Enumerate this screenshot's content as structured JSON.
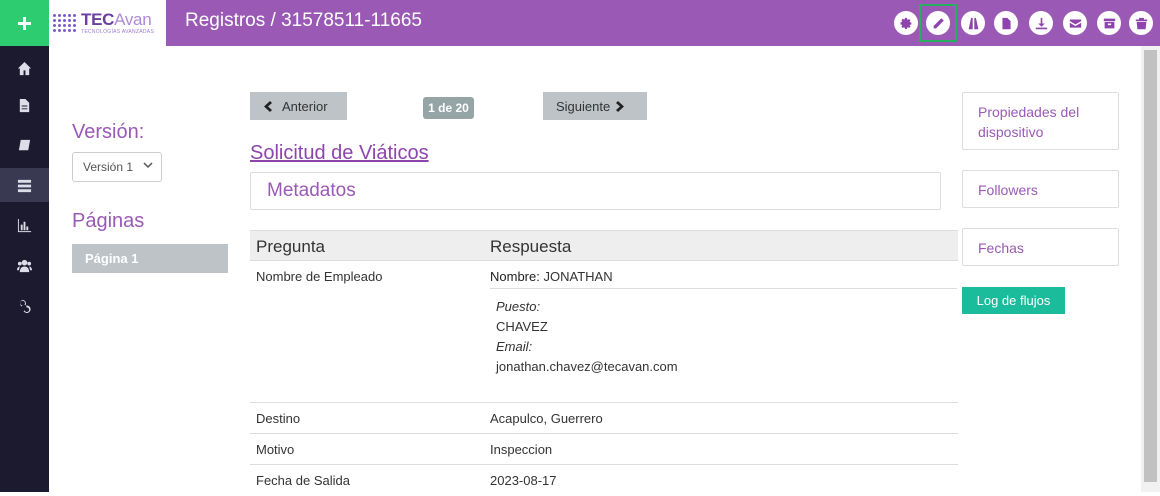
{
  "header": {
    "logo": {
      "main_tec": "TEC",
      "main_avan": "Avan",
      "sub": "TECNOLOGÍAS AVANZADAS"
    },
    "title": "Registros / 31578511-11665",
    "add_icon": "plus-icon",
    "colors": {
      "bar": "#9b59b6",
      "add": "#2ecc71",
      "highlight": "#27ae60"
    }
  },
  "toolbar": {
    "items": [
      {
        "icon": "gear-icon"
      },
      {
        "icon": "pencil-icon",
        "highlighted": true
      },
      {
        "icon": "road-icon"
      },
      {
        "icon": "file-icon"
      },
      {
        "icon": "download-icon"
      },
      {
        "icon": "envelope-icon"
      },
      {
        "icon": "archive-icon"
      },
      {
        "icon": "trash-icon"
      }
    ]
  },
  "sidebar": {
    "items": [
      {
        "icon": "home-icon"
      },
      {
        "icon": "document-icon"
      },
      {
        "icon": "book-icon"
      },
      {
        "icon": "list-icon",
        "active": true
      },
      {
        "icon": "bar-chart-icon"
      },
      {
        "icon": "users-icon"
      },
      {
        "icon": "link-icon"
      }
    ]
  },
  "left_panel": {
    "version_title": "Versión:",
    "version_selected": "Versión 1",
    "pages_title": "Páginas",
    "page_item": "Página 1"
  },
  "navigation": {
    "previous": "Anterior",
    "counter": "1 de 20",
    "next": "Siguiente"
  },
  "form": {
    "title": "Solicitud de Viáticos",
    "metadata": "Metadatos"
  },
  "table": {
    "headers": {
      "question": "Pregunta",
      "answer": "Respuesta"
    },
    "employee": {
      "question": "Nombre de Empleado",
      "name_label": "Nombre:",
      "name_value": "JONATHAN",
      "position_label": "Puesto:",
      "position_value": "CHAVEZ",
      "email_label": "Email:",
      "email_value": "jonathan.chavez@tecavan.com"
    },
    "rows": [
      {
        "question": "Destino",
        "answer": "Acapulco, Guerrero"
      },
      {
        "question": "Motivo",
        "answer": "Inspeccion"
      },
      {
        "question": "Fecha de Salida",
        "answer": "2023-08-17"
      }
    ]
  },
  "right_panel": {
    "device_properties": "Propiedades del dispositivo",
    "followers": "Followers",
    "dates": "Fechas",
    "flow_log": "Log de flujos"
  }
}
